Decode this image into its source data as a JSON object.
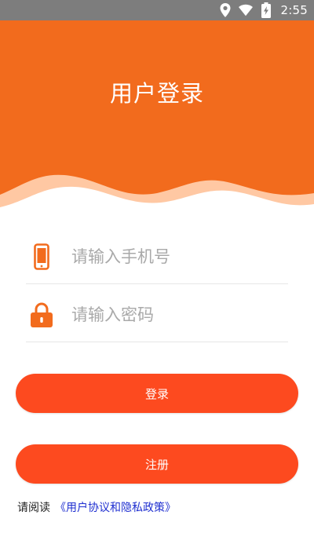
{
  "status_bar": {
    "time": "2:55",
    "icons": [
      "location-icon",
      "wifi-icon",
      "battery-charging-icon"
    ]
  },
  "header": {
    "title": "用户登录",
    "colors": {
      "primary": "#f26b1d",
      "wave_light": "#ffc8a3"
    }
  },
  "form": {
    "phone": {
      "placeholder": "请输入手机号",
      "value": "",
      "icon": "phone-icon"
    },
    "password": {
      "placeholder": "请输入密码",
      "value": "",
      "icon": "lock-icon"
    }
  },
  "buttons": {
    "login_label": "登录",
    "register_label": "注册",
    "color": "#fd4a1f"
  },
  "agreement": {
    "prefix": "请阅读",
    "link_text": "《用户协议和隐私政策》",
    "link_color": "#1f2fd0"
  }
}
